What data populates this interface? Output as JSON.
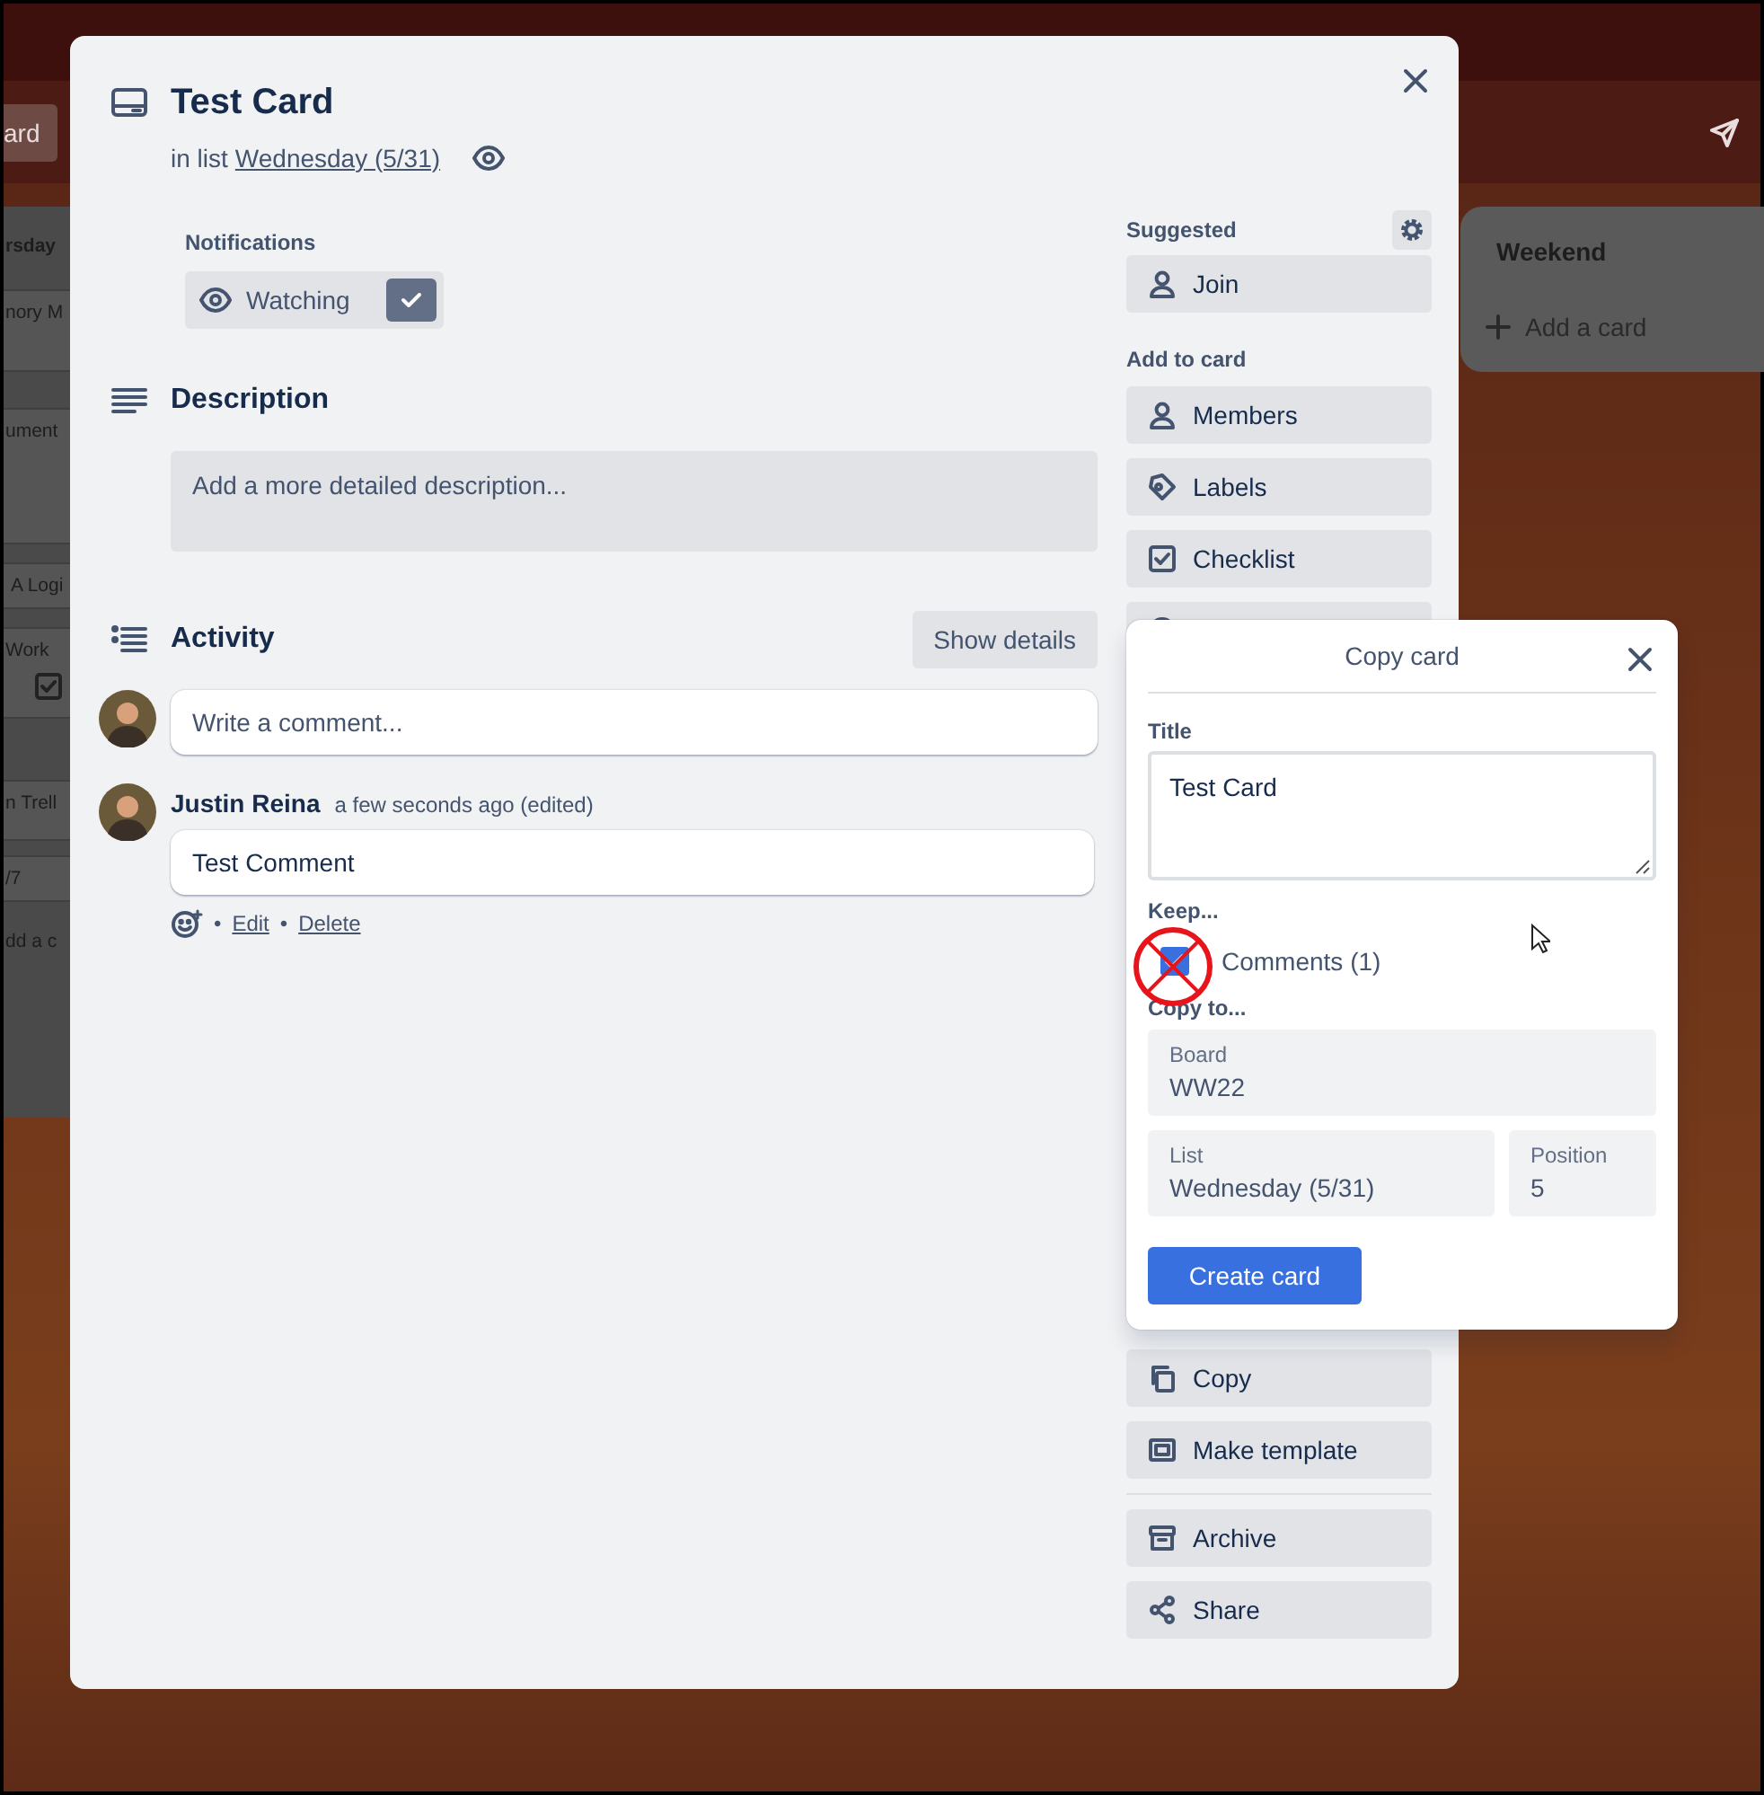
{
  "board": {
    "header_button": "ard",
    "left_list": {
      "title": "rsday",
      "cards": [
        {
          "text": "nory M"
        },
        {
          "text": "ument"
        },
        {
          "text": "A Logi"
        },
        {
          "text": "Work",
          "checklist": true
        },
        {
          "text": "n Trell"
        },
        {
          "text": "/7"
        }
      ],
      "add_card": "dd a c"
    },
    "right_list": {
      "title": "Weekend",
      "add_card": "Add a card"
    }
  },
  "card": {
    "title": "Test Card",
    "list_prefix": "in list",
    "list_name": "Wednesday (5/31)",
    "notifications": {
      "heading": "Notifications",
      "label": "Watching",
      "watching": true
    },
    "description": {
      "heading": "Description",
      "placeholder": "Add a more detailed description..."
    },
    "activity": {
      "heading": "Activity",
      "show_details": "Show details",
      "comment_placeholder": "Write a comment...",
      "comments": [
        {
          "author": "Justin Reina",
          "time": "a few seconds ago (edited)",
          "text": "Test Comment",
          "separator": "•",
          "actions": [
            "Edit",
            "Delete"
          ]
        }
      ]
    }
  },
  "sidebar": {
    "suggested": {
      "heading": "Suggested",
      "buttons": [
        "Join"
      ]
    },
    "add_to_card": {
      "heading": "Add to card",
      "buttons": [
        "Members",
        "Labels",
        "Checklist"
      ]
    },
    "actions": {
      "groups": [
        [
          "Copy",
          "Make template"
        ],
        [
          "Archive",
          "Share"
        ]
      ]
    }
  },
  "copy_popup": {
    "title": "Copy card",
    "title_label": "Title",
    "title_value": "Test Card",
    "keep_heading": "Keep...",
    "keep": [
      {
        "label": "Comments (1)",
        "checked": true
      }
    ],
    "copy_to_heading": "Copy to...",
    "fields": [
      {
        "label": "Board",
        "value": "WW22"
      },
      {
        "label": "List",
        "value": "Wednesday (5/31)"
      },
      {
        "label": "Position",
        "value": "5"
      }
    ],
    "submit": "Create card"
  }
}
